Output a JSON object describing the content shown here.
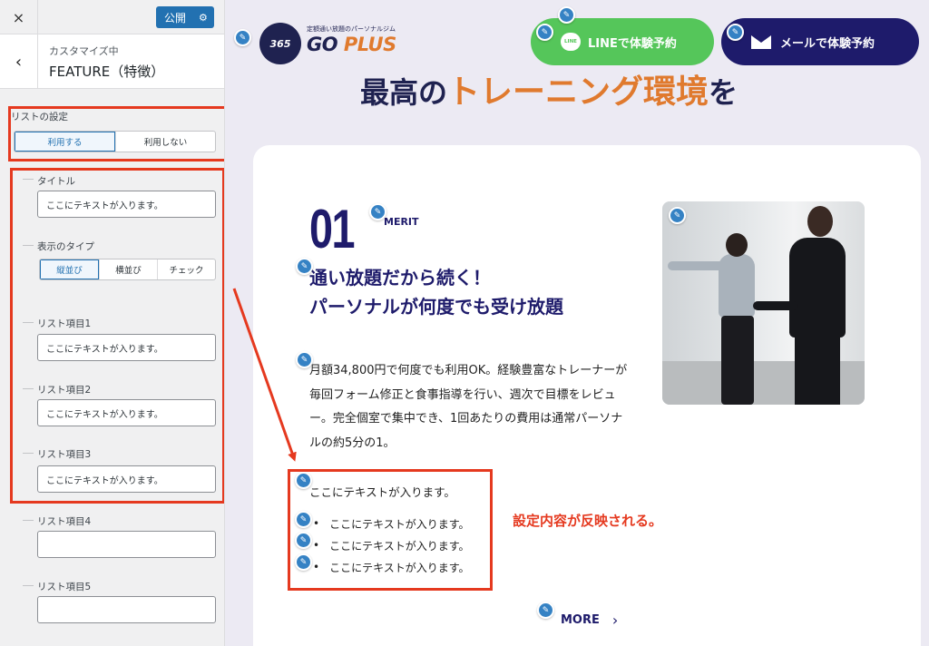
{
  "panel": {
    "close_icon": "×",
    "publish_label": "公開",
    "publish_gear": "⚙",
    "back_icon": "‹",
    "crumb": "カスタマイズ中",
    "section_title": "FEATURE（特徴）",
    "list_setting_label": "リストの設定",
    "list_setting_options": [
      "利用する",
      "利用しない"
    ],
    "list_setting_selected": "利用する",
    "title_label": "タイトル",
    "title_value": "ここにテキストが入ります。",
    "display_type_label": "表示のタイプ",
    "display_type_options": [
      "縦並び",
      "横並び",
      "チェック"
    ],
    "display_type_selected": "縦並び",
    "items": [
      {
        "label": "リスト項目1",
        "value": "ここにテキストが入ります。"
      },
      {
        "label": "リスト項目2",
        "value": "ここにテキストが入ります。"
      },
      {
        "label": "リスト項目3",
        "value": "ここにテキストが入ります。"
      },
      {
        "label": "リスト項目4",
        "value": ""
      },
      {
        "label": "リスト項目5",
        "value": ""
      }
    ]
  },
  "preview": {
    "logo": {
      "badge": "365",
      "tagline": "定額通い放題のパーソナルジム",
      "text_main": "GO ",
      "text_accent": "PLUS"
    },
    "line_icon": "LINE",
    "line_button": "LINEで体験予約",
    "mail_button": "メールで体験予約",
    "headline_prefix": "最高の",
    "headline_accent": "トレーニング環境",
    "headline_suffix": "を",
    "feature": {
      "number": "01",
      "tag": "MERIT",
      "subtitle_line1": "通い放題だから続く！",
      "subtitle_line2": "パーソナルが何度でも受け放題",
      "body": "月額34,800円で何度でも利用OK。経験豊富なトレーナーが毎回フォーム修正と食事指導を行い、週次で目標をレビュー。完全個室で集中でき、1回あたりの費用は通常パーソナルの約5分の1。",
      "list_title": "ここにテキストが入ります。",
      "list_items": [
        "ここにテキストが入ります。",
        "ここにテキストが入ります。",
        "ここにテキストが入ります。"
      ],
      "more_label": "MORE",
      "more_chevron": "›"
    },
    "annotation_note": "設定内容が反映される。"
  },
  "colors": {
    "annotation_red": "#e5391f",
    "navy": "#1e1b6b",
    "orange": "#e07a2e",
    "line_green": "#55c65a",
    "wp_blue": "#2271b1"
  }
}
